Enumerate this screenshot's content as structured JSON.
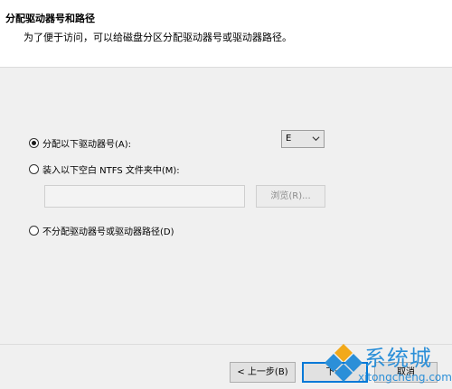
{
  "header": {
    "title": "分配驱动器号和路径",
    "subtitle": "为了便于访问，可以给磁盘分区分配驱动器号或驱动器路径。"
  },
  "options": {
    "assign_letter": {
      "label": "分配以下驱动器号(A):",
      "checked": true
    },
    "mount_folder": {
      "label": "装入以下空白 NTFS 文件夹中(M):",
      "checked": false
    },
    "none": {
      "label": "不分配驱动器号或驱动器路径(D)",
      "checked": false
    }
  },
  "drive_select": {
    "value": "E"
  },
  "folder_path": {
    "value": ""
  },
  "browse": {
    "label": "浏览(R)..."
  },
  "footer": {
    "back_label": "< 上一步(B)",
    "next_label": "下一",
    "cancel_label": "取消"
  },
  "watermark": {
    "cn": "系统城",
    "en": "xitongcheng.com"
  },
  "colors": {
    "accent": "#0078d7",
    "watermark": "#2b8fd8"
  }
}
